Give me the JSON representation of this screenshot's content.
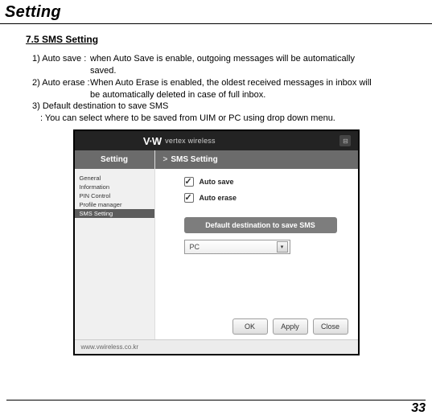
{
  "doc_title": "Setting",
  "section_heading": "7.5 SMS Setting",
  "items": [
    {
      "label": "1) Auto save :",
      "desc_line1": "when Auto Save is enable, outgoing messages will be automatically",
      "desc_line2_indent": "saved."
    },
    {
      "label": "2) Auto erase :",
      "desc_line1": "When Auto Erase is enabled, the oldest received messages in inbox will",
      "desc_line2_indent": "be automatically deleted in case of full inbox."
    }
  ],
  "item3_line1": "3) Default destination to save SMS",
  "item3_line2": ":  You can select where to be saved from UIM or PC using drop down menu.",
  "screenshot": {
    "brand_mark": "V·W",
    "brand_text": "vertex wireless",
    "close_glyph": "⊟",
    "sidebar": {
      "header": "Setting",
      "items": [
        "General",
        "Information",
        "PIN Control",
        "Profile manager",
        "SMS Setting"
      ],
      "selected_index": 4
    },
    "main": {
      "breadcrumb_gt": ">",
      "breadcrumb_label": "SMS Setting",
      "check1": "Auto save",
      "check2": "Auto erase",
      "dest_label": "Default destination to save SMS",
      "dropdown_value": "PC",
      "dropdown_glyph": "▾",
      "buttons": {
        "ok": "OK",
        "apply": "Apply",
        "close": "Close"
      }
    },
    "footer_url": "www.vwireless.co.kr"
  },
  "page_number": "33"
}
